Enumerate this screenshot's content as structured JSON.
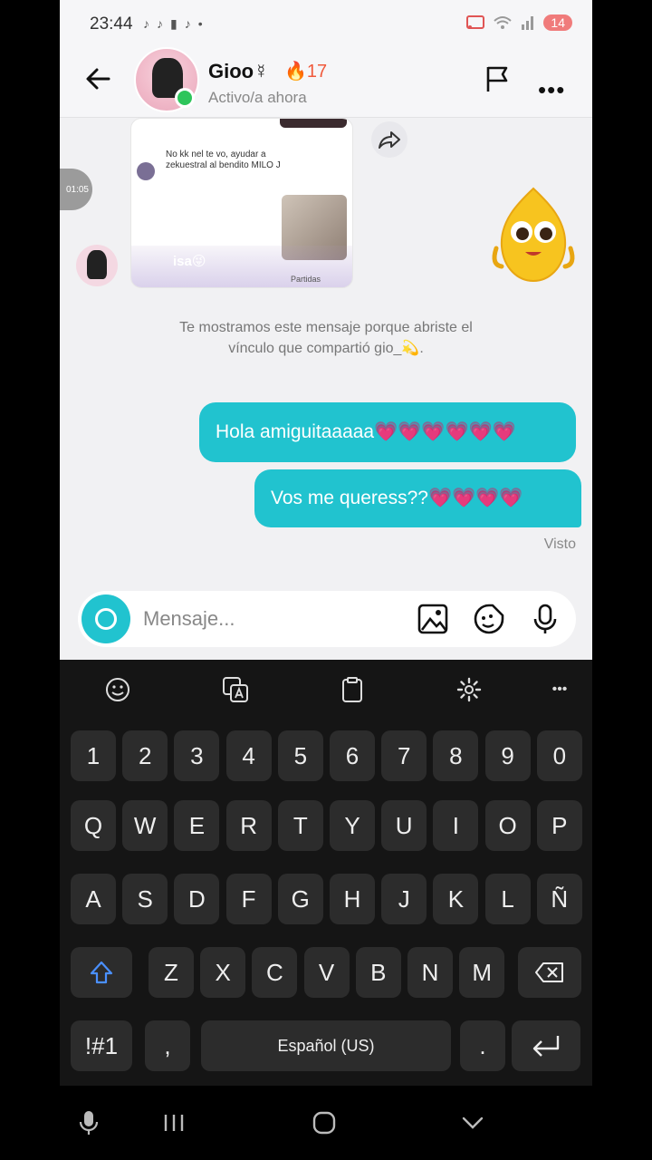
{
  "status_bar": {
    "time": "23:44",
    "left_icons": [
      "tiktok-icon",
      "tiktok-icon",
      "notification-icon",
      "tiktok-icon",
      "dot-icon"
    ],
    "right_icons": [
      "cast-icon",
      "wifi-icon",
      "signal-icon"
    ],
    "battery": "14"
  },
  "header": {
    "name": "Gioo",
    "name_suffix": "☿",
    "streak": "🔥17",
    "status": "Activo/a ahora"
  },
  "shared_post": {
    "text": "No kk nel te vo, ayudar a zekuestral al bendito MILO J",
    "user": "isa😜",
    "tag": "Partidas",
    "side_tab": "01:05"
  },
  "notice": {
    "line1": "Te mostramos este mensaje porque abriste el",
    "line2": "vínculo que compartió gio_💫."
  },
  "messages": [
    {
      "text": "Hola amiguitaaaaa",
      "hearts": "💗💗💗💗💗💗"
    },
    {
      "text": "Vos me queress??",
      "hearts": "💗💗💗💗"
    }
  ],
  "seen_label": "Visto",
  "composer": {
    "placeholder": "Mensaje..."
  },
  "keyboard": {
    "row_numbers": [
      "1",
      "2",
      "3",
      "4",
      "5",
      "6",
      "7",
      "8",
      "9",
      "0"
    ],
    "row_q": [
      "Q",
      "W",
      "E",
      "R",
      "T",
      "Y",
      "U",
      "I",
      "O",
      "P"
    ],
    "row_a": [
      "A",
      "S",
      "D",
      "F",
      "G",
      "H",
      "J",
      "K",
      "L",
      "Ñ"
    ],
    "row_z": [
      "Z",
      "X",
      "C",
      "V",
      "B",
      "N",
      "M"
    ],
    "symbols_key": "!#1",
    "comma_key": ",",
    "space_key": "Español (US)",
    "period_key": ".",
    "toolbar_more": "•••"
  },
  "colors": {
    "accent": "#21c3cf",
    "online": "#2ec55b",
    "streak": "#f05a3c",
    "keyboard_bg": "#151515",
    "key_bg": "#2c2c2c"
  }
}
